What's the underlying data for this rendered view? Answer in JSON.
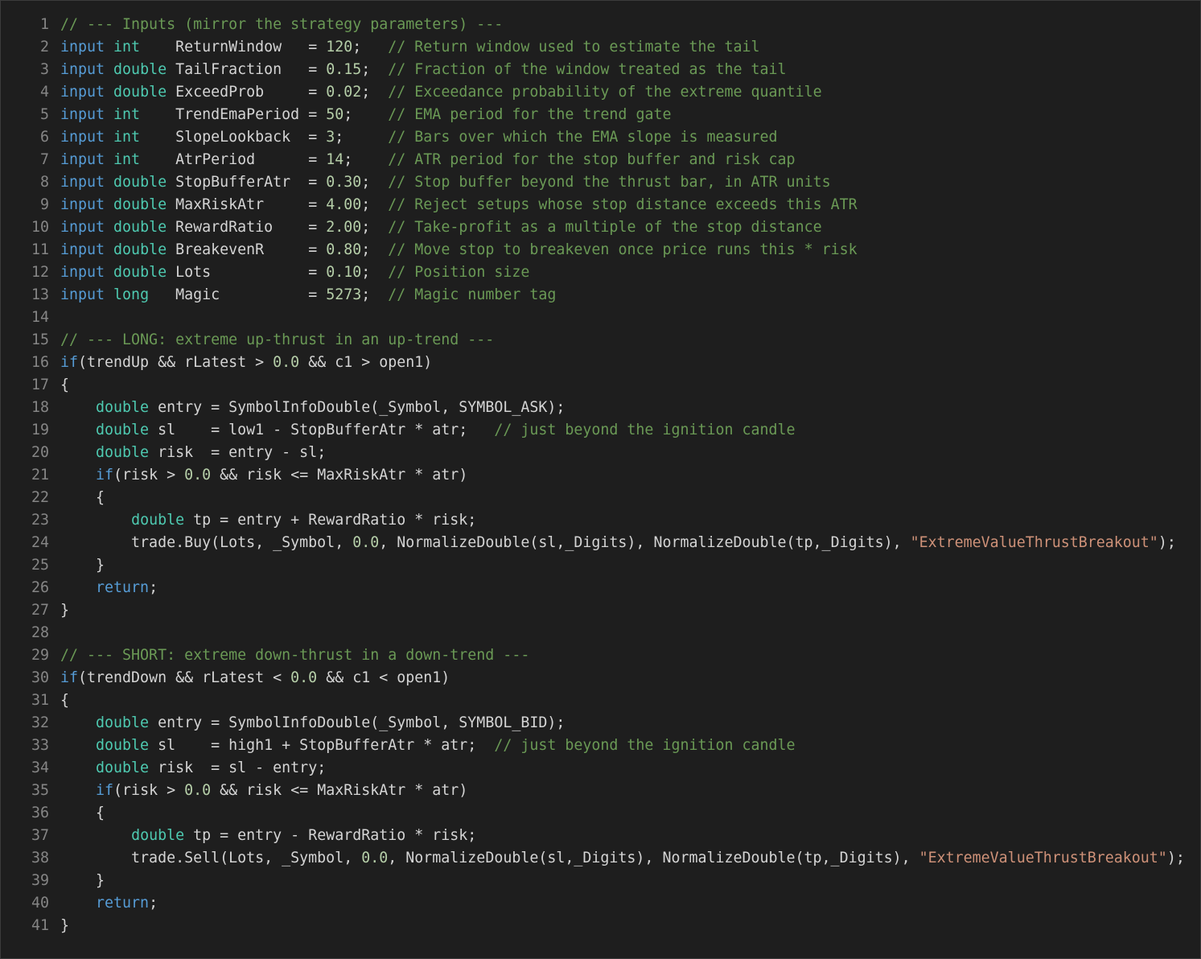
{
  "colors": {
    "background": "#1e1e1e",
    "comment": "#6a9955",
    "keyword": "#569cd6",
    "type": "#4ec9b0",
    "number": "#b5cea8",
    "string": "#ce9178",
    "text": "#d4d4d4",
    "line_number": "#858585"
  },
  "lines": [
    {
      "n": "1",
      "tokens": [
        [
          "c",
          "// --- Inputs (mirror the strategy parameters) ---"
        ]
      ]
    },
    {
      "n": "2",
      "tokens": [
        [
          "k",
          "input "
        ],
        [
          "t",
          "int   "
        ],
        [
          "p",
          " ReturnWindow   = "
        ],
        [
          "n",
          "120"
        ],
        [
          "p",
          ";   "
        ],
        [
          "c",
          "// Return window used to estimate the tail"
        ]
      ]
    },
    {
      "n": "3",
      "tokens": [
        [
          "k",
          "input "
        ],
        [
          "t",
          "double"
        ],
        [
          "p",
          " TailFraction   = "
        ],
        [
          "n",
          "0.15"
        ],
        [
          "p",
          ";  "
        ],
        [
          "c",
          "// Fraction of the window treated as the tail"
        ]
      ]
    },
    {
      "n": "4",
      "tokens": [
        [
          "k",
          "input "
        ],
        [
          "t",
          "double"
        ],
        [
          "p",
          " ExceedProb     = "
        ],
        [
          "n",
          "0.02"
        ],
        [
          "p",
          ";  "
        ],
        [
          "c",
          "// Exceedance probability of the extreme quantile"
        ]
      ]
    },
    {
      "n": "5",
      "tokens": [
        [
          "k",
          "input "
        ],
        [
          "t",
          "int   "
        ],
        [
          "p",
          " TrendEmaPeriod = "
        ],
        [
          "n",
          "50"
        ],
        [
          "p",
          ";    "
        ],
        [
          "c",
          "// EMA period for the trend gate"
        ]
      ]
    },
    {
      "n": "6",
      "tokens": [
        [
          "k",
          "input "
        ],
        [
          "t",
          "int   "
        ],
        [
          "p",
          " SlopeLookback  = "
        ],
        [
          "n",
          "3"
        ],
        [
          "p",
          ";     "
        ],
        [
          "c",
          "// Bars over which the EMA slope is measured"
        ]
      ]
    },
    {
      "n": "7",
      "tokens": [
        [
          "k",
          "input "
        ],
        [
          "t",
          "int   "
        ],
        [
          "p",
          " AtrPeriod      = "
        ],
        [
          "n",
          "14"
        ],
        [
          "p",
          ";    "
        ],
        [
          "c",
          "// ATR period for the stop buffer and risk cap"
        ]
      ]
    },
    {
      "n": "8",
      "tokens": [
        [
          "k",
          "input "
        ],
        [
          "t",
          "double"
        ],
        [
          "p",
          " StopBufferAtr  = "
        ],
        [
          "n",
          "0.30"
        ],
        [
          "p",
          ";  "
        ],
        [
          "c",
          "// Stop buffer beyond the thrust bar, in ATR units"
        ]
      ]
    },
    {
      "n": "9",
      "tokens": [
        [
          "k",
          "input "
        ],
        [
          "t",
          "double"
        ],
        [
          "p",
          " MaxRiskAtr     = "
        ],
        [
          "n",
          "4.00"
        ],
        [
          "p",
          ";  "
        ],
        [
          "c",
          "// Reject setups whose stop distance exceeds this ATR"
        ]
      ]
    },
    {
      "n": "10",
      "tokens": [
        [
          "k",
          "input "
        ],
        [
          "t",
          "double"
        ],
        [
          "p",
          " RewardRatio    = "
        ],
        [
          "n",
          "2.00"
        ],
        [
          "p",
          ";  "
        ],
        [
          "c",
          "// Take-profit as a multiple of the stop distance"
        ]
      ]
    },
    {
      "n": "11",
      "tokens": [
        [
          "k",
          "input "
        ],
        [
          "t",
          "double"
        ],
        [
          "p",
          " BreakevenR     = "
        ],
        [
          "n",
          "0.80"
        ],
        [
          "p",
          ";  "
        ],
        [
          "c",
          "// Move stop to breakeven once price runs this * risk"
        ]
      ]
    },
    {
      "n": "12",
      "tokens": [
        [
          "k",
          "input "
        ],
        [
          "t",
          "double"
        ],
        [
          "p",
          " Lots           = "
        ],
        [
          "n",
          "0.10"
        ],
        [
          "p",
          ";  "
        ],
        [
          "c",
          "// Position size"
        ]
      ]
    },
    {
      "n": "13",
      "tokens": [
        [
          "k",
          "input "
        ],
        [
          "t",
          "long  "
        ],
        [
          "p",
          " Magic          = "
        ],
        [
          "n",
          "5273"
        ],
        [
          "p",
          ";  "
        ],
        [
          "c",
          "// Magic number tag"
        ]
      ]
    },
    {
      "n": "14",
      "tokens": []
    },
    {
      "n": "15",
      "tokens": [
        [
          "c",
          "// --- LONG: extreme up-thrust in an up-trend ---"
        ]
      ]
    },
    {
      "n": "16",
      "tokens": [
        [
          "k",
          "if"
        ],
        [
          "p",
          "(trendUp && rLatest > "
        ],
        [
          "n",
          "0.0"
        ],
        [
          "p",
          " && c1 > open1)"
        ]
      ]
    },
    {
      "n": "17",
      "tokens": [
        [
          "p",
          "{"
        ]
      ]
    },
    {
      "n": "18",
      "tokens": [
        [
          "p",
          "    "
        ],
        [
          "t",
          "double"
        ],
        [
          "p",
          " entry = SymbolInfoDouble(_Symbol, SYMBOL_ASK);"
        ]
      ]
    },
    {
      "n": "19",
      "tokens": [
        [
          "p",
          "    "
        ],
        [
          "t",
          "double"
        ],
        [
          "p",
          " sl    = low1 - StopBufferAtr * atr;   "
        ],
        [
          "c",
          "// just beyond the ignition candle"
        ]
      ]
    },
    {
      "n": "20",
      "tokens": [
        [
          "p",
          "    "
        ],
        [
          "t",
          "double"
        ],
        [
          "p",
          " risk  = entry - sl;"
        ]
      ]
    },
    {
      "n": "21",
      "tokens": [
        [
          "p",
          "    "
        ],
        [
          "k",
          "if"
        ],
        [
          "p",
          "(risk > "
        ],
        [
          "n",
          "0.0"
        ],
        [
          "p",
          " && risk <= MaxRiskAtr * atr)"
        ]
      ]
    },
    {
      "n": "22",
      "tokens": [
        [
          "p",
          "    {"
        ]
      ]
    },
    {
      "n": "23",
      "tokens": [
        [
          "p",
          "        "
        ],
        [
          "t",
          "double"
        ],
        [
          "p",
          " tp = entry + RewardRatio * risk;"
        ]
      ]
    },
    {
      "n": "24",
      "tokens": [
        [
          "p",
          "        trade.Buy(Lots, _Symbol, "
        ],
        [
          "n",
          "0.0"
        ],
        [
          "p",
          ", NormalizeDouble(sl,_Digits), NormalizeDouble(tp,_Digits), "
        ],
        [
          "s",
          "\"ExtremeValueThrustBreakout\""
        ],
        [
          "p",
          ");"
        ]
      ]
    },
    {
      "n": "25",
      "tokens": [
        [
          "p",
          "    }"
        ]
      ]
    },
    {
      "n": "26",
      "tokens": [
        [
          "p",
          "    "
        ],
        [
          "k",
          "return"
        ],
        [
          "p",
          ";"
        ]
      ]
    },
    {
      "n": "27",
      "tokens": [
        [
          "p",
          "}"
        ]
      ]
    },
    {
      "n": "28",
      "tokens": []
    },
    {
      "n": "29",
      "tokens": [
        [
          "c",
          "// --- SHORT: extreme down-thrust in a down-trend ---"
        ]
      ]
    },
    {
      "n": "30",
      "tokens": [
        [
          "k",
          "if"
        ],
        [
          "p",
          "(trendDown && rLatest < "
        ],
        [
          "n",
          "0.0"
        ],
        [
          "p",
          " && c1 < open1)"
        ]
      ]
    },
    {
      "n": "31",
      "tokens": [
        [
          "p",
          "{"
        ]
      ]
    },
    {
      "n": "32",
      "tokens": [
        [
          "p",
          "    "
        ],
        [
          "t",
          "double"
        ],
        [
          "p",
          " entry = SymbolInfoDouble(_Symbol, SYMBOL_BID);"
        ]
      ]
    },
    {
      "n": "33",
      "tokens": [
        [
          "p",
          "    "
        ],
        [
          "t",
          "double"
        ],
        [
          "p",
          " sl    = high1 + StopBufferAtr * atr;  "
        ],
        [
          "c",
          "// just beyond the ignition candle"
        ]
      ]
    },
    {
      "n": "34",
      "tokens": [
        [
          "p",
          "    "
        ],
        [
          "t",
          "double"
        ],
        [
          "p",
          " risk  = sl - entry;"
        ]
      ]
    },
    {
      "n": "35",
      "tokens": [
        [
          "p",
          "    "
        ],
        [
          "k",
          "if"
        ],
        [
          "p",
          "(risk > "
        ],
        [
          "n",
          "0.0"
        ],
        [
          "p",
          " && risk <= MaxRiskAtr * atr)"
        ]
      ]
    },
    {
      "n": "36",
      "tokens": [
        [
          "p",
          "    {"
        ]
      ]
    },
    {
      "n": "37",
      "tokens": [
        [
          "p",
          "        "
        ],
        [
          "t",
          "double"
        ],
        [
          "p",
          " tp = entry - RewardRatio * risk;"
        ]
      ]
    },
    {
      "n": "38",
      "tokens": [
        [
          "p",
          "        trade.Sell(Lots, _Symbol, "
        ],
        [
          "n",
          "0.0"
        ],
        [
          "p",
          ", NormalizeDouble(sl,_Digits), NormalizeDouble(tp,_Digits), "
        ],
        [
          "s",
          "\"ExtremeValueThrustBreakout\""
        ],
        [
          "p",
          ");"
        ]
      ]
    },
    {
      "n": "39",
      "tokens": [
        [
          "p",
          "    }"
        ]
      ]
    },
    {
      "n": "40",
      "tokens": [
        [
          "p",
          "    "
        ],
        [
          "k",
          "return"
        ],
        [
          "p",
          ";"
        ]
      ]
    },
    {
      "n": "41",
      "tokens": [
        [
          "p",
          "}"
        ]
      ]
    }
  ]
}
